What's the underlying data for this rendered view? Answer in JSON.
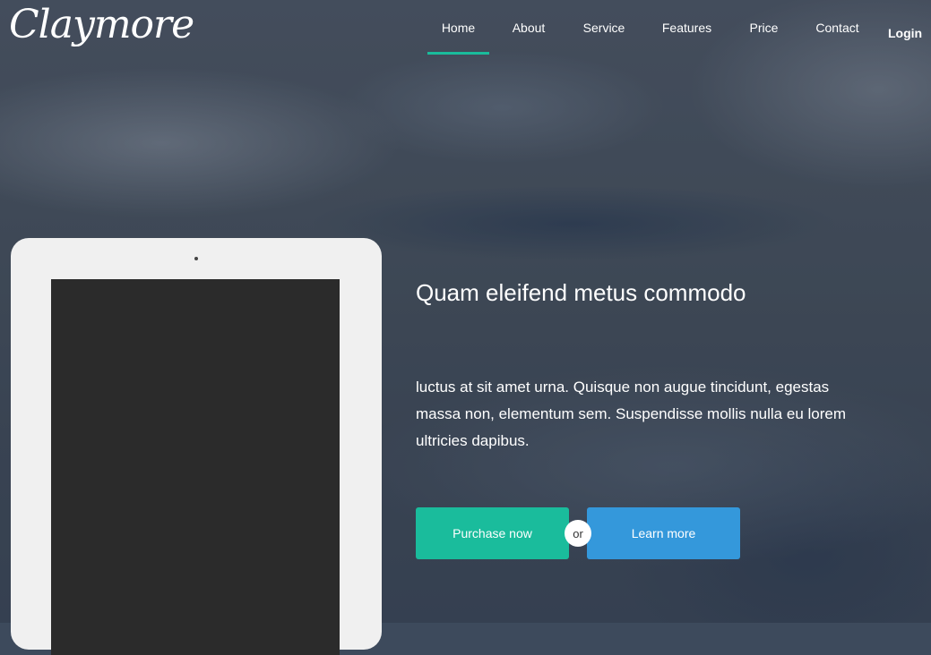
{
  "brand": {
    "logo_text": "Claymore"
  },
  "nav": {
    "items": [
      {
        "label": "Home",
        "active": true
      },
      {
        "label": "About",
        "active": false
      },
      {
        "label": "Service",
        "active": false
      },
      {
        "label": "Features",
        "active": false
      },
      {
        "label": "Price",
        "active": false
      },
      {
        "label": "Contact",
        "active": false
      }
    ],
    "login_label": "Login",
    "active_underline_color": "#1abc9c"
  },
  "hero": {
    "headline": "Quam eleifend metus commodo",
    "description": "luctus at sit amet urna. Quisque non augue tincidunt, egestas massa non, elementum sem. Suspendisse mollis nulla eu lorem ultricies dapibus.",
    "purchase_label": "Purchase now",
    "separator": "or",
    "learn_label": "Learn more",
    "purchase_color": "#1abc9c",
    "learn_color": "#3498db"
  },
  "device": {
    "type": "tablet-mockup",
    "frame_color": "#f0f0f0",
    "screen_color": "#2b2b2b"
  }
}
